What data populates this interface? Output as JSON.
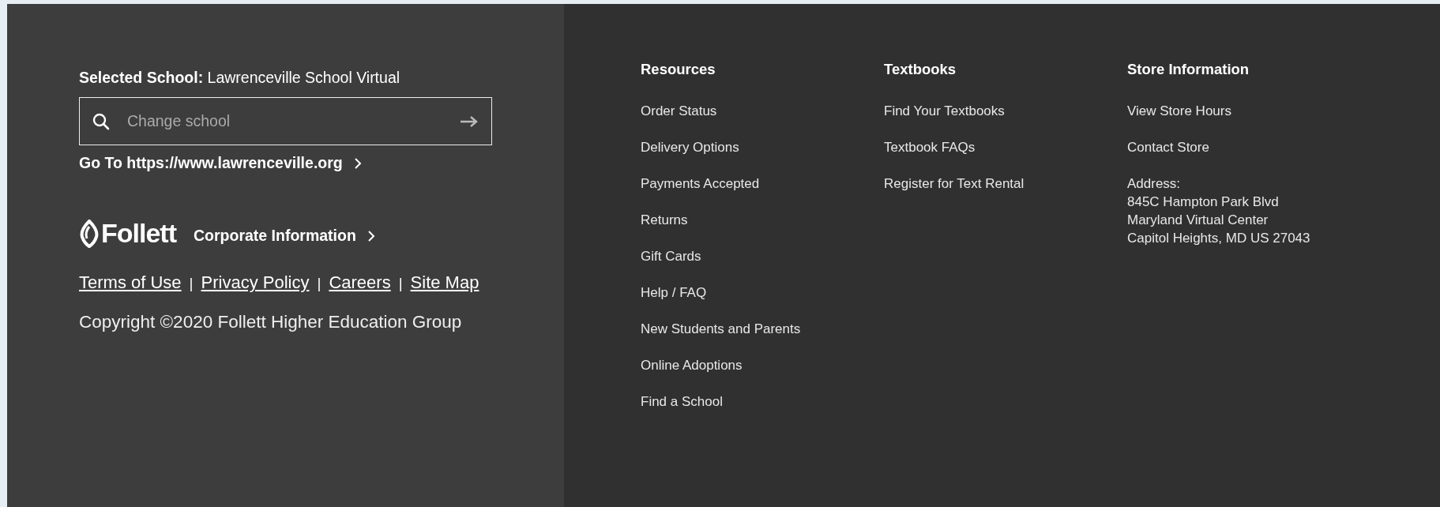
{
  "school_panel": {
    "selected_label": "Selected School:",
    "selected_value": "Lawrenceville School Virtual",
    "search": {
      "placeholder": "Change school"
    },
    "goto_link": "Go To https://www.lawrenceville.org",
    "logo_text": "Follett",
    "corporate_link": "Corporate Information",
    "legal_links": [
      "Terms of Use",
      "Privacy Policy",
      "Careers",
      "Site Map"
    ],
    "separator": "|",
    "copyright": "Copyright ©2020 Follett Higher Education Group"
  },
  "columns": [
    {
      "heading": "Resources",
      "links": [
        "Order Status",
        "Delivery Options",
        "Payments Accepted",
        "Returns",
        "Gift Cards",
        "Help / FAQ",
        "New Students and Parents",
        "Online Adoptions",
        "Find a School"
      ]
    },
    {
      "heading": "Textbooks",
      "links": [
        "Find Your Textbooks",
        "Textbook FAQs",
        "Register for Text Rental"
      ]
    },
    {
      "heading": "Store Information",
      "links": [
        "View Store Hours",
        "Contact Store"
      ],
      "address": {
        "label": "Address:",
        "lines": [
          "845C Hampton Park Blvd",
          "Maryland Virtual Center",
          "Capitol Heights, MD US 27043"
        ]
      }
    }
  ]
}
